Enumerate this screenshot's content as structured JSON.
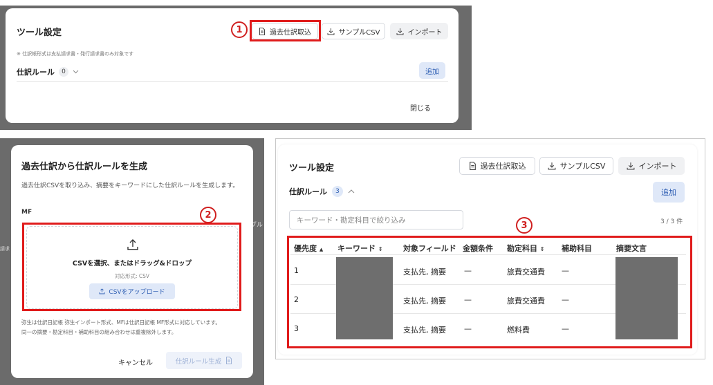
{
  "panel1": {
    "title": "ツール設定",
    "btn_past": "過去仕訳取込",
    "btn_sample": "サンプルCSV",
    "btn_import": "インポート",
    "note": "※ 仕訳帳形式は支払請求書・発行請求書のみ対象です",
    "rule_label": "仕訳ルール",
    "rule_count": "0",
    "add": "追加",
    "close": "閉じる",
    "marker": "1"
  },
  "panel2": {
    "title": "過去仕訳から仕訳ルールを生成",
    "desc": "過去仕訳CSVを取り込み、摘要をキーワードにした仕訳ルールを生成します。",
    "source": "MF",
    "drop_text": "CSVを選択、またはドラッグ&ドロップ",
    "format": "対応形式: CSV",
    "upload": "CSVをアップロード",
    "footnote1": "弥生は仕訳日記帳 弥生インポート形式、MFは仕訳日記帳 MF形式に対応しています。",
    "footnote2": "同一の摘要・勘定科目・補助科目の組み合わせは重複除外します。",
    "cancel": "キャンセル",
    "generate": "仕訳ルール生成",
    "bg_fragment_1": "ブル",
    "bg_fragment_2": "請求",
    "marker": "2"
  },
  "panel3": {
    "title": "ツール設定",
    "btn_past": "過去仕訳取込",
    "btn_sample": "サンプルCSV",
    "btn_import": "インポート",
    "rule_label": "仕訳ルール",
    "rule_count": "3",
    "add": "追加",
    "filter_placeholder": "キーワード・勘定科目で絞り込み",
    "count": "3 / 3 件",
    "marker": "3",
    "headers": [
      "優先度",
      "キーワード",
      "対象フィールド",
      "金額条件",
      "勘定科目",
      "補助科目",
      "摘要文言"
    ],
    "rows": [
      {
        "priority": "1",
        "field": "支払先, 摘要",
        "amount": "—",
        "account": "旅費交通費",
        "sub": "—"
      },
      {
        "priority": "2",
        "field": "支払先, 摘要",
        "amount": "—",
        "account": "旅費交通費",
        "sub": "—"
      },
      {
        "priority": "3",
        "field": "支払先, 摘要",
        "amount": "—",
        "account": "燃料費",
        "sub": "—"
      }
    ]
  }
}
